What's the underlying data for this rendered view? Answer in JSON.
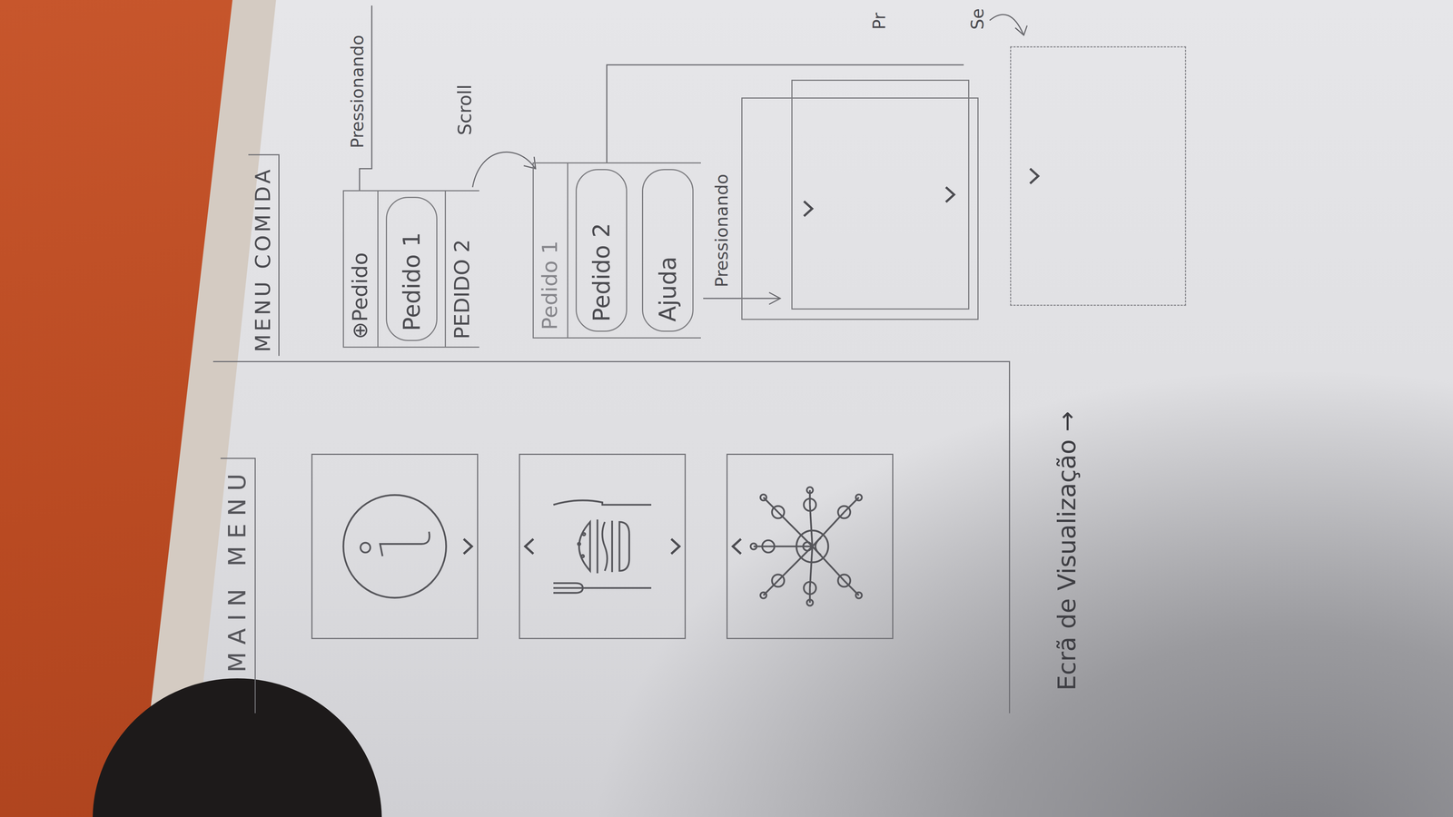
{
  "main_menu": {
    "title": "MAIN MENU",
    "cards": [
      {
        "kind": "info",
        "prev": false,
        "next": true
      },
      {
        "kind": "food",
        "prev": true,
        "next": true
      },
      {
        "kind": "network",
        "prev": true,
        "next": false
      }
    ]
  },
  "menu_comida": {
    "title": "MENU COMIDA",
    "list_1": [
      {
        "label": "⊕Pedido",
        "kind": "row",
        "faded": false
      },
      {
        "label": "Pedido 1",
        "kind": "pill",
        "faded": false
      },
      {
        "label": "PEDIDO 2",
        "kind": "row",
        "faded": false
      }
    ],
    "list_2": [
      {
        "label": "Pedido 1",
        "kind": "row",
        "faded": true
      },
      {
        "label": "Pedido 2",
        "kind": "pill",
        "faded": false
      },
      {
        "label": "Ajuda",
        "kind": "pill",
        "faded": false
      }
    ],
    "notes": {
      "press_top": "Pressionando",
      "scroll": "Scroll",
      "press_help": "Pressionando",
      "cut_1": "Pr",
      "cut_2": "Se"
    },
    "view_boxes": [
      {
        "dashed": false
      },
      {
        "dashed": false
      },
      {
        "dashed": true
      }
    ]
  },
  "caption": "Ecrã de Visualização →"
}
